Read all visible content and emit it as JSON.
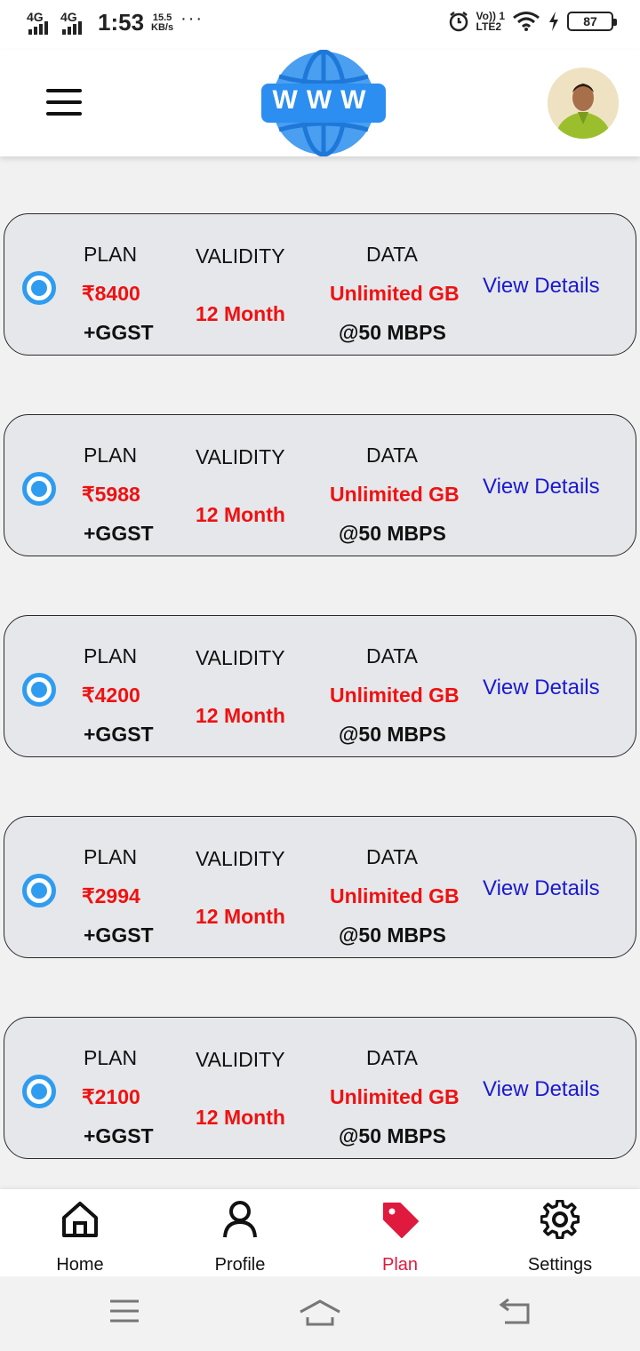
{
  "status_bar": {
    "network1": "4G",
    "network2": "4G",
    "time": "1:53",
    "speed_value": "15.5",
    "speed_unit": "KB/s",
    "more": "···",
    "volte": "Vo)) 1",
    "lte": "LTE2",
    "battery": "87"
  },
  "header": {
    "logo_text": "WWW"
  },
  "plans": [
    {
      "plan_label": "PLAN",
      "price": "₹8400",
      "tax": "+GGST",
      "validity_label": "VALIDITY",
      "validity": "12 Month",
      "data_label": "DATA",
      "data": "Unlimited GB",
      "speed": "@50 MBPS",
      "link": "View Details"
    },
    {
      "plan_label": "PLAN",
      "price": "₹5988",
      "tax": "+GGST",
      "validity_label": "VALIDITY",
      "validity": "12 Month",
      "data_label": "DATA",
      "data": "Unlimited GB",
      "speed": "@50 MBPS",
      "link": "View Details"
    },
    {
      "plan_label": "PLAN",
      "price": "₹4200",
      "tax": "+GGST",
      "validity_label": "VALIDITY",
      "validity": "12 Month",
      "data_label": "DATA",
      "data": "Unlimited GB",
      "speed": "@50 MBPS",
      "link": "View Details"
    },
    {
      "plan_label": "PLAN",
      "price": "₹2994",
      "tax": "+GGST",
      "validity_label": "VALIDITY",
      "validity": "12 Month",
      "data_label": "DATA",
      "data": "Unlimited GB",
      "speed": "@50 MBPS",
      "link": "View Details"
    },
    {
      "plan_label": "PLAN",
      "price": "₹2100",
      "tax": "+GGST",
      "validity_label": "VALIDITY",
      "validity": "12 Month",
      "data_label": "DATA",
      "data": "Unlimited GB",
      "speed": "@50 MBPS",
      "link": "View Details"
    }
  ],
  "nav": {
    "items": [
      {
        "label": "Home",
        "icon": "home-icon"
      },
      {
        "label": "Profile",
        "icon": "person-icon"
      },
      {
        "label": "Plan",
        "icon": "tag-icon"
      },
      {
        "label": "Settings",
        "icon": "gear-icon"
      }
    ],
    "active": "Plan"
  },
  "colors": {
    "price_red": "#ee1212",
    "link_blue": "#1a1ad0",
    "radio_blue": "#2f9cf0",
    "active_nav": "#e0193f",
    "card_bg": "#e6e7ea"
  }
}
